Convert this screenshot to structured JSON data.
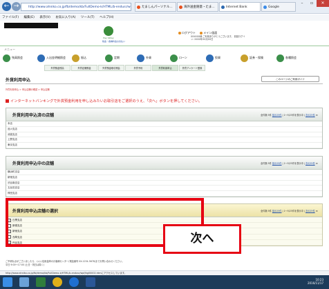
{
  "browser": {
    "address": "http://www.ahniko.co.jp/fb/demo/kb/FullDemo-k/HTML/b-endusr/wpf/kg00001.htm",
    "tabs": [
      "たましんパーソナル...",
      "海外送金随意・たま...",
      "Internet Bank",
      "Google"
    ],
    "window_controls": [
      "–",
      "▫",
      "✕"
    ],
    "menu": [
      "ファイル(F)",
      "編集(E)",
      "表示(V)",
      "お気に入り(A)",
      "ツール(T)",
      "ヘルプ(H)"
    ]
  },
  "header": {
    "logo_text": "Pay Valley",
    "logo_sub": "税金・各種料金お支払い",
    "logout": "ログアウト",
    "main_screen": "メイン画面",
    "login_info": "XXXXXX様 ご利用ありがとうございます。 前回ログイン: XXXX年XX月XX日"
  },
  "menu_label": "メニュー",
  "nav": [
    {
      "label": "残高照会",
      "color": "#3b8f4a"
    },
    {
      "label": "入出金明細照会",
      "color": "#2e6cb5"
    },
    {
      "label": "振込",
      "color": "#c8a02c"
    },
    {
      "label": "定期",
      "color": "#3b8f4a"
    },
    {
      "label": "外貨",
      "color": "#2e6cb5"
    },
    {
      "label": "ローン",
      "color": "#3b8f4a"
    },
    {
      "label": "投資",
      "color": "#2e6cb5"
    },
    {
      "label": "証券・保険",
      "color": "#c8a02c"
    },
    {
      "label": "各種照会",
      "color": "#3b8f4a"
    }
  ],
  "subnav": [
    "外貨預金残高",
    "外貨定期預金",
    "外貨預金取引照会",
    "外貨予約",
    "外貨利用申込",
    "外貨アンケート登録"
  ],
  "page": {
    "title": "外貨利用申込",
    "guide_button": "このページのご利用ガイド",
    "breadcrumb": "外貨利用申込 > 申込店舗の確認 > 申込店舗",
    "instruction": "インターネットバンキングで外貨預金利用を申し込みたいお取引店をご選択のうえ、「次へ」ボタンを押してください。"
  },
  "panels": [
    {
      "title": "外貨利用申込済の店舗",
      "info_prefix": "全件数:",
      "count": "5件",
      "prev": "前の25件",
      "range": "1〜5/25件を表示中",
      "next": "次の25件",
      "rows": [
        "本店",
        "品川支店",
        "池袋支店",
        "上野支店",
        "東京支店"
      ]
    },
    {
      "title": "外貨利用申込中の店舗",
      "info_prefix": "全件数:",
      "count": "5件",
      "prev": "前の25件",
      "range": "1〜5/25件を表示中",
      "next": "次の25件",
      "rows": [
        "横浜町支店",
        "新宿支店",
        "渋谷南支店",
        "五反田支店",
        "神田支店"
      ]
    },
    {
      "title": "外貨利用申込店舗の選択",
      "info_prefix": "全件数:",
      "count": "5件",
      "prev": "前の25件",
      "range": "1〜5/25件を表示中",
      "next": "次の25件",
      "rows": [
        {
          "label": "日黒支店",
          "checked": true
        },
        {
          "label": "新橋支店",
          "checked": false
        },
        {
          "label": "新宿支店",
          "checked": false
        },
        {
          "label": "浅草支店",
          "checked": false
        },
        {
          "label": "丹谷支店",
          "checked": false
        }
      ]
    }
  ],
  "next_button": "次へ",
  "footer": {
    "line1": "ご不明な点がございましたら、○○○信用金庫のお客様センター(電話番号 0X-1234-5678)までお問い合わせください。",
    "line2": "平日 9:00〜17:00 (土日・祝日は除く)"
  },
  "status_url": "http://www.ahniko.co.jp/fb/demo/kb/FullDemo-k/HTML/b-endusr/wpf/kg00002.htmにアクセスしています。",
  "clock": {
    "time": "10:23",
    "date": "2016/11/17"
  },
  "colors": {
    "red": "#e60012",
    "navy": "#1c3b5a"
  }
}
